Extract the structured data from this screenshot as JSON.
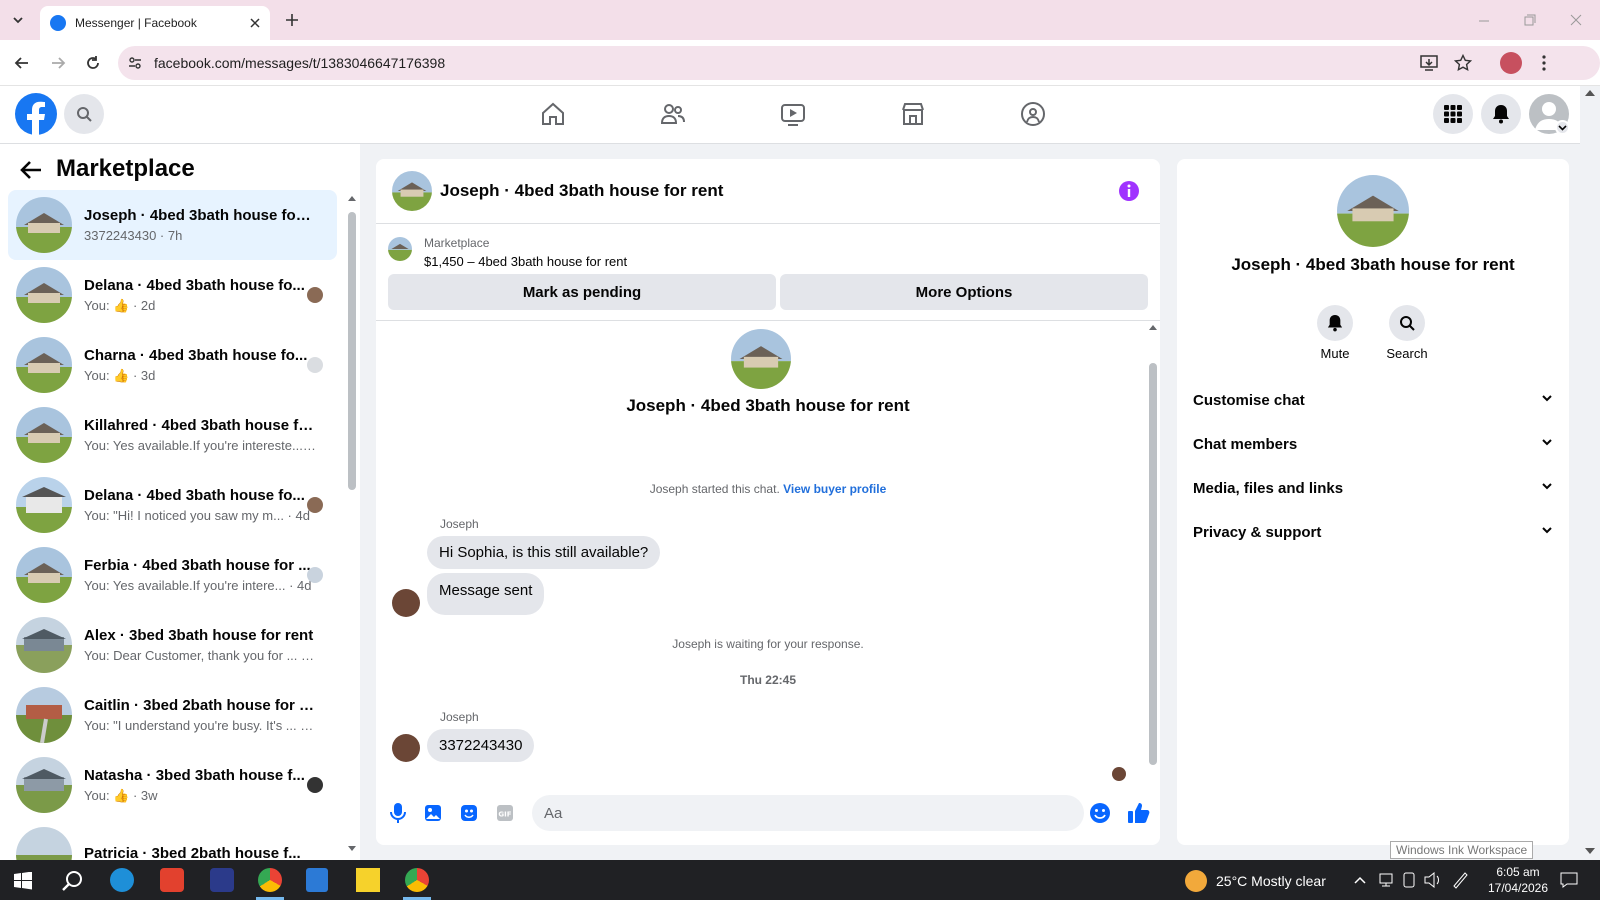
{
  "browser": {
    "tab_title": "Messenger | Facebook",
    "url": "facebook.com/messages/t/1383046647176398"
  },
  "left_panel": {
    "title": "Marketplace",
    "conversations": [
      {
        "name": "Joseph · 4bed 3bath house for r...",
        "preview": "3372243430 · 7h"
      },
      {
        "name": "Delana · 4bed 3bath house fo...",
        "preview": "You: 👍 · 2d"
      },
      {
        "name": "Charna · 4bed 3bath house fo...",
        "preview": "You: 👍 · 3d"
      },
      {
        "name": "Killahred · 4bed 3bath house for...",
        "preview": "You: Yes available.If you're intereste... · 4d"
      },
      {
        "name": "Delana · 4bed 3bath house fo...",
        "preview": "You: \"Hi! I noticed you saw my m... · 4d"
      },
      {
        "name": "Ferbia · 4bed 3bath house for ...",
        "preview": "You: Yes available.If you're intere... · 4d"
      },
      {
        "name": "Alex · 3bed 3bath house for rent",
        "preview": "You: Dear Customer, thank you for ... · 2w"
      },
      {
        "name": "Caitlin · 3bed 2bath house for re...",
        "preview": "You: \"I understand you're busy. It's ... · 3w"
      },
      {
        "name": "Natasha · 3bed 3bath house f...",
        "preview": "You: 👍 · 3w"
      },
      {
        "name": "Patricia · 3bed 2bath house f...",
        "preview": ""
      }
    ]
  },
  "chat": {
    "header_title": "Joseph · 4bed 3bath house for rent",
    "listing_source": "Marketplace",
    "listing_title": "$1,450 – 4bed 3bath house for rent",
    "mark_pending_label": "Mark as pending",
    "more_options_label": "More Options",
    "intro_name": "Joseph · 4bed 3bath house for rent",
    "started_text": "Joseph started this chat.",
    "buyer_profile_link": "View buyer profile",
    "sender_1": "Joseph",
    "msg_1": "Hi Sophia, is this still available?",
    "msg_2": "Message sent",
    "waiting_text": "Joseph is waiting for your response.",
    "timestamp": "Thu 22:45",
    "sender_2": "Joseph",
    "msg_3": "3372243430",
    "composer_placeholder": "Aa"
  },
  "info": {
    "name": "Joseph · 4bed 3bath house for rent",
    "mute_label": "Mute",
    "search_label": "Search",
    "sections": [
      "Customise chat",
      "Chat members",
      "Media, files and links",
      "Privacy & support"
    ]
  },
  "tooltip": "Windows Ink Workspace",
  "taskbar": {
    "temperature": "25°C",
    "weather": "Mostly clear",
    "time": "6:05 am",
    "date": "17/04/2026"
  },
  "colors": {
    "fb_blue": "#1877f2",
    "accent_purple": "#a033ff",
    "link_blue": "#216fdb"
  }
}
